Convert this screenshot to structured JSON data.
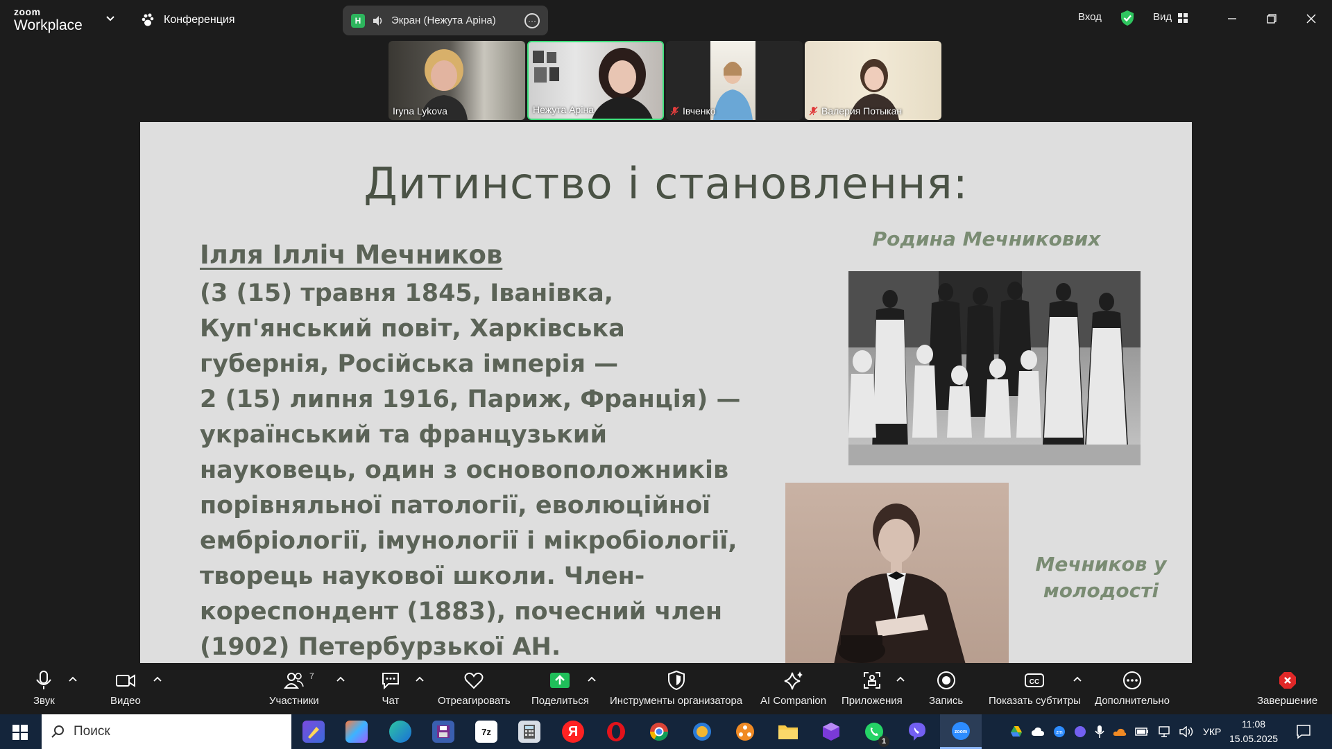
{
  "app": {
    "brand_top": "zoom",
    "brand_bottom": "Workplace",
    "meeting_label": "Конференция",
    "share_badge": "Н",
    "share_label": "Экран (Нежута Аріна)",
    "signin": "Вход",
    "view": "Вид"
  },
  "participants": [
    {
      "name": "Iryna Lykova",
      "muted": false
    },
    {
      "name": "Нежута Аріна",
      "muted": false,
      "active": true
    },
    {
      "name": "Івченко",
      "muted": true
    },
    {
      "name": "Валерия Потыкан",
      "muted": true
    }
  ],
  "slide": {
    "title": "Дитинство і становлення:",
    "name": "Ілля Ілліч Мечников",
    "lines": [
      "(3 (15) травня 1845, Іванівка,",
      "Куп'янський повіт, Харківська",
      "губернія, Російська імперія —",
      "2 (15) липня 1916, Париж, Франція) —",
      "український та французький",
      "науковець, один з основоположників",
      "порівняльної патології, еволюційної",
      "ембріології, імунології і мікробіології,",
      "творець наукової школи. Член-",
      "кореспондент (1883), почесний член",
      "(1902) Петербурзької АН."
    ],
    "caption_family": "Родина Мечникових",
    "caption_young_1": "Мечников у",
    "caption_young_2": "молодості"
  },
  "toolbar": {
    "audio": "Звук",
    "video": "Видео",
    "participants": "Участники",
    "participants_count": "7",
    "chat": "Чат",
    "react": "Отреагировать",
    "share": "Поделиться",
    "host_tools": "Инструменты организатора",
    "ai": "AI Companion",
    "apps": "Приложения",
    "record": "Запись",
    "captions": "Показать субтитры",
    "more": "Дополнительно",
    "end": "Завершение"
  },
  "taskbar": {
    "search_placeholder": "Поиск",
    "lang": "УКР",
    "time": "11:08",
    "date": "15.05.2025",
    "whatsapp_badge": "1"
  },
  "colors": {
    "accent_green": "#3ee07c",
    "slide_bg": "#dedede",
    "slide_text": "#5b6357",
    "caption": "#7a8c73",
    "end_red": "#e02828"
  }
}
